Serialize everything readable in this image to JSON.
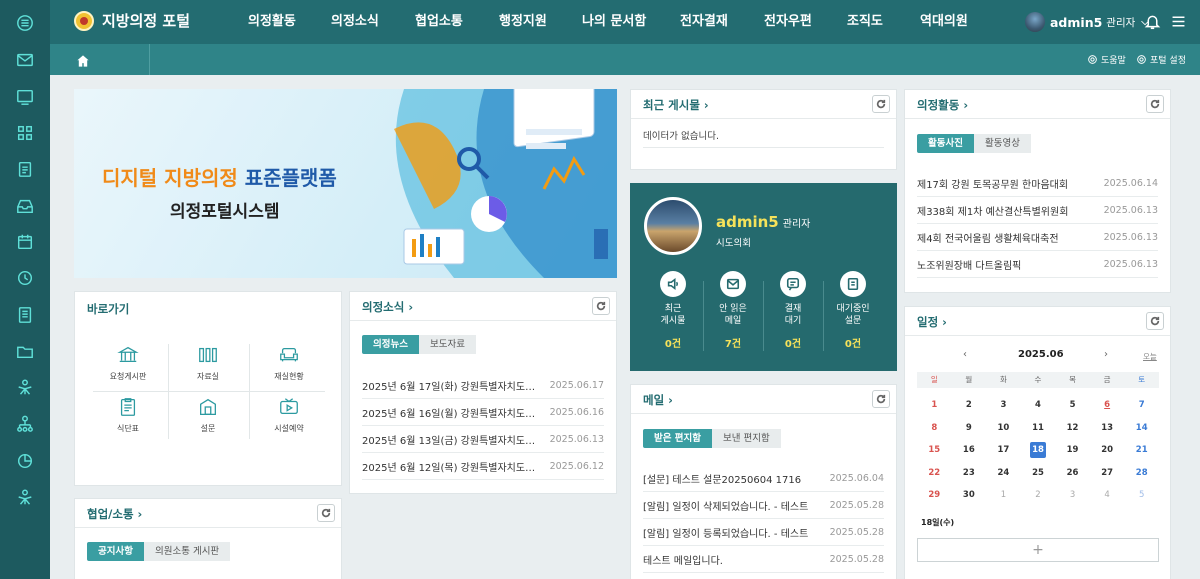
{
  "app": {
    "title": "지방의정 포털"
  },
  "nav": [
    "의정활동",
    "의정소식",
    "협업소통",
    "행정지원",
    "나의 문서함",
    "전자결재",
    "전자우편",
    "조직도",
    "역대의원"
  ],
  "user": {
    "name": "admin5",
    "role": "관리자"
  },
  "subbar": {
    "help": "도움말",
    "settings": "포털 설정"
  },
  "banner": {
    "line1_a": "디지털 지방의정",
    "line1_b": "표준플랫폼",
    "line2": "의정포털시스템"
  },
  "quicklinks": {
    "title": "바로가기",
    "items": [
      "요청게시판",
      "자료실",
      "재실현황",
      "식단표",
      "설문",
      "시설예약"
    ]
  },
  "news": {
    "title": "의정소식 ›",
    "tabs": [
      "의정뉴스",
      "보도자료"
    ],
    "rows": [
      {
        "t": "2025년 6월 17일(화) 강원특별자치도의...",
        "d": "2025.06.17"
      },
      {
        "t": "2025년 6월 16일(월) 강원특별자치도의...",
        "d": "2025.06.16"
      },
      {
        "t": "2025년 6월 13일(금) 강원특별자치도의...",
        "d": "2025.06.13"
      },
      {
        "t": "2025년 6월 12일(목) 강원특별자치도의...",
        "d": "2025.06.12"
      }
    ]
  },
  "collab": {
    "title": "협업/소통 ›",
    "tabs": [
      "공지사항",
      "의원소통 게시판"
    ]
  },
  "recent": {
    "title": "최근 게시물 ›",
    "empty": "데이터가 없습니다."
  },
  "profile": {
    "name": "admin5",
    "role": "관리자",
    "org": "시도의회",
    "stats": [
      {
        "label1": "최근",
        "label2": "게시물",
        "value": "0건"
      },
      {
        "label1": "안 읽은",
        "label2": "메일",
        "value": "7건"
      },
      {
        "label1": "결재",
        "label2": "대기",
        "value": "0건"
      },
      {
        "label1": "대기중인",
        "label2": "설문",
        "value": "0건"
      }
    ]
  },
  "mail": {
    "title": "메일 ›",
    "tabs": [
      "받은 편지함",
      "보낸 편지함"
    ],
    "rows": [
      {
        "t": "[설문] 테스트 설문20250604 1716",
        "d": "2025.06.04"
      },
      {
        "t": "[알림] 일정이 삭제되었습니다. - 테스트",
        "d": "2025.05.28"
      },
      {
        "t": "[알림] 일정이 등록되었습니다. - 테스트",
        "d": "2025.05.28"
      },
      {
        "t": "테스트 메일입니다.",
        "d": "2025.05.28"
      }
    ]
  },
  "activity": {
    "title": "의정활동 ›",
    "tabs": [
      "활동사진",
      "활동영상"
    ],
    "rows": [
      {
        "t": "제17회 강원 토목공무원 한마음대회",
        "d": "2025.06.14"
      },
      {
        "t": "제338회 제1차 예산결산특별위원회",
        "d": "2025.06.13"
      },
      {
        "t": "제4회 전국어울림 생활체육대축전",
        "d": "2025.06.13"
      },
      {
        "t": "노조위원장배 다트올림픽",
        "d": "2025.06.13"
      }
    ]
  },
  "schedule": {
    "title": "일정 ›",
    "month": "2025.06",
    "today_btn": "오늘",
    "prev": "‹",
    "next": "›",
    "weekdays": [
      "일",
      "월",
      "화",
      "수",
      "목",
      "금",
      "토"
    ],
    "days": [
      "1",
      "2",
      "3",
      "4",
      "5",
      "6",
      "7",
      "8",
      "9",
      "10",
      "11",
      "12",
      "13",
      "14",
      "15",
      "16",
      "17",
      "18",
      "19",
      "20",
      "21",
      "22",
      "23",
      "24",
      "25",
      "26",
      "27",
      "28",
      "29",
      "30",
      "1",
      "2",
      "3",
      "4",
      "5"
    ],
    "selected": "18일(수)",
    "add": "+"
  },
  "colors": {
    "header": "#236c71",
    "accent": "#3a9ea2",
    "highlight": "#f6e25a"
  }
}
